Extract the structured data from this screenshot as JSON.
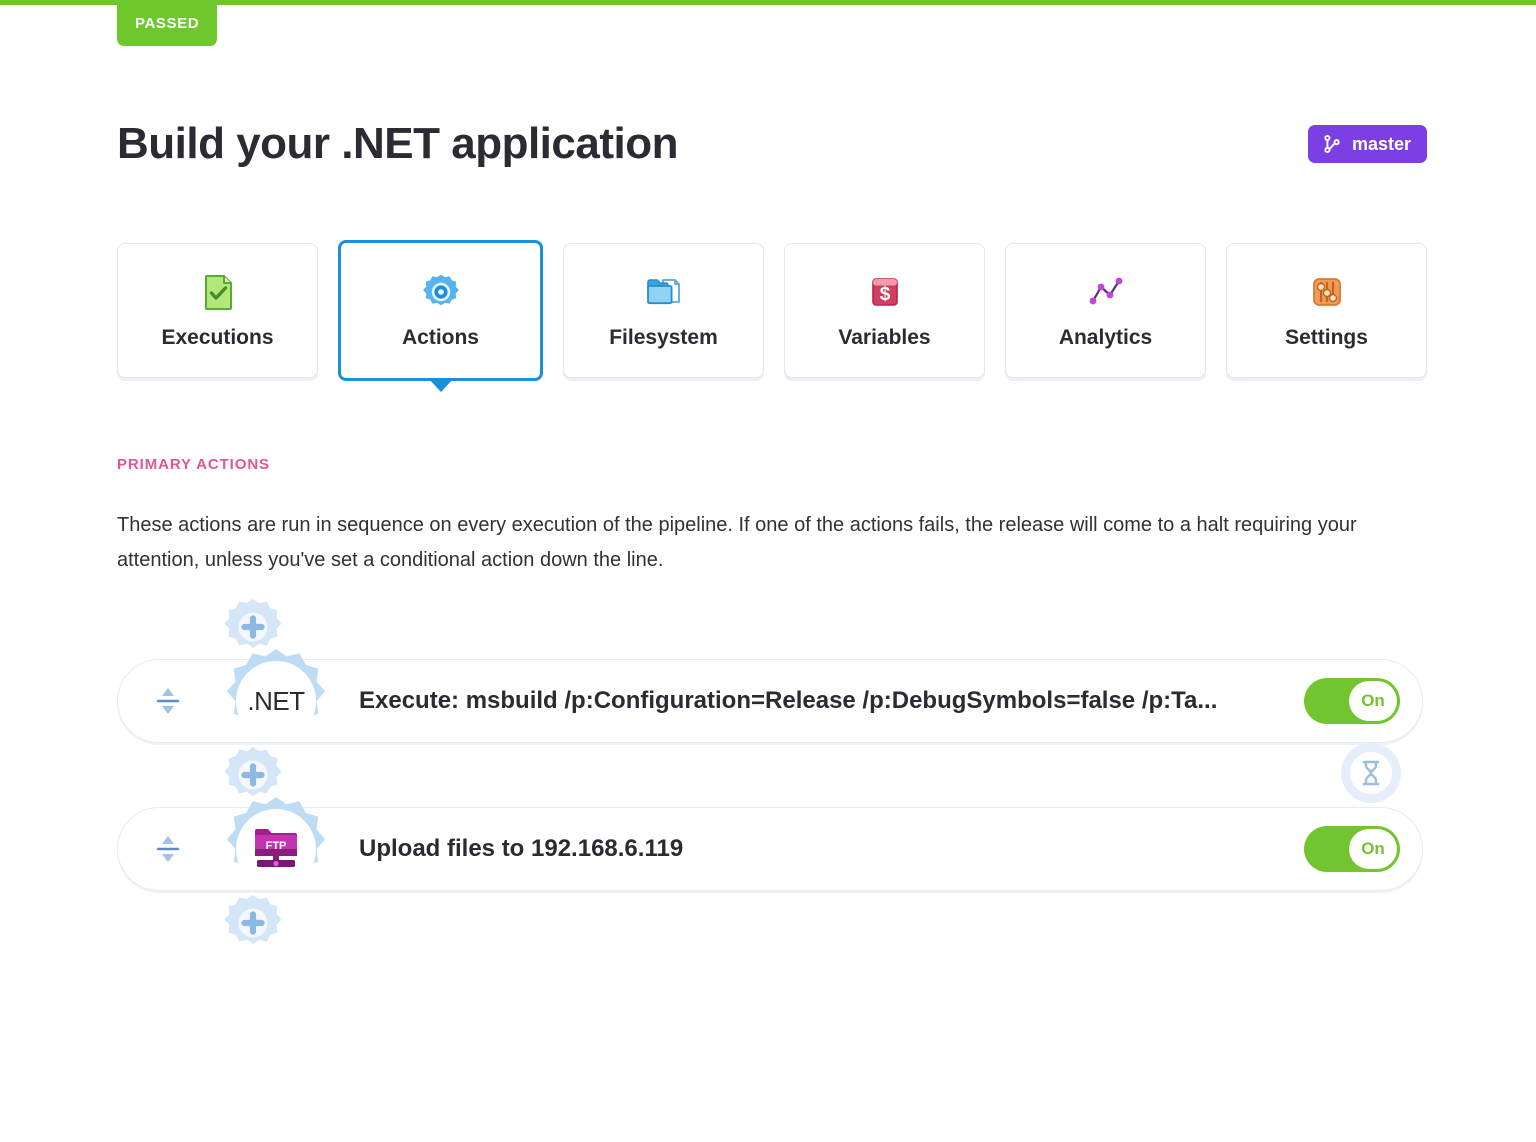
{
  "status": {
    "label": "PASSED",
    "color": "#6ec82c"
  },
  "header": {
    "title": "Build your .NET application",
    "branch": {
      "label": "master",
      "icon": "git-branch-icon",
      "color": "#7b3fe4"
    }
  },
  "tabs": [
    {
      "label": "Executions",
      "icon": "document-check-icon",
      "active": false
    },
    {
      "label": "Actions",
      "icon": "gear-icon",
      "active": true
    },
    {
      "label": "Filesystem",
      "icon": "folder-file-icon",
      "active": false
    },
    {
      "label": "Variables",
      "icon": "dollar-box-icon",
      "active": false
    },
    {
      "label": "Analytics",
      "icon": "line-chart-icon",
      "active": false
    },
    {
      "label": "Settings",
      "icon": "sliders-icon",
      "active": false
    }
  ],
  "section": {
    "label": "PRIMARY ACTIONS",
    "label_color": "#e0559b",
    "description": "These actions are run in sequence on every execution of the pipeline. If one of the actions fails, the release will come to a halt requiring your attention, unless you've set a conditional action down the line."
  },
  "pipeline": {
    "add_label": "+",
    "timer_icon": "hourglass-icon",
    "actions": [
      {
        "icon": "dotnet-icon",
        "icon_text": ".NET",
        "title": "Execute: msbuild /p:Configuration=Release /p:DebugSymbols=false /p:Ta...",
        "toggle_label": "On",
        "toggle_on": true
      },
      {
        "icon": "ftp-folder-icon",
        "icon_text": "FTP",
        "title": "Upload files to 192.168.6.119",
        "toggle_label": "On",
        "toggle_on": true
      }
    ]
  }
}
